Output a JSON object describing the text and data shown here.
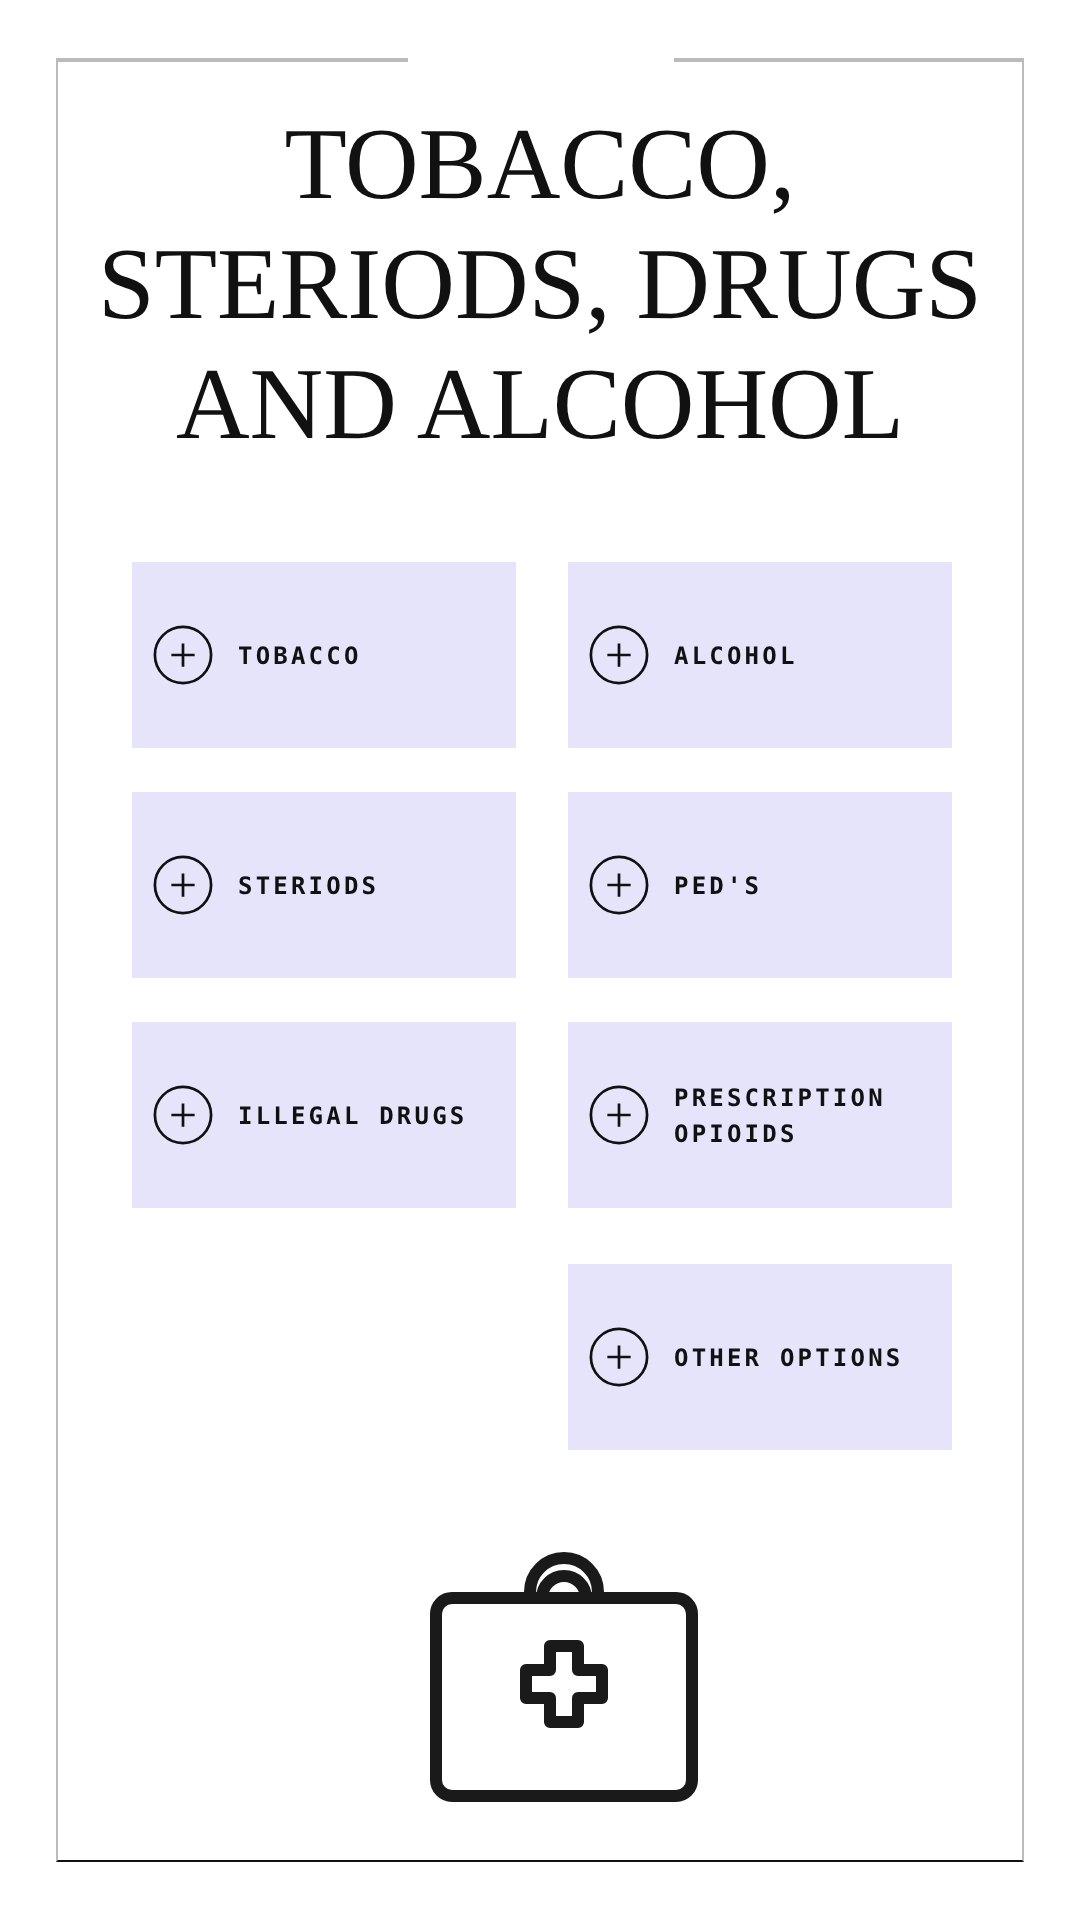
{
  "title": "TOBACCO, STERIODS, DRUGS AND ALCOHOL",
  "topic_columns": [
    {
      "topics": [
        {
          "label": "TOBACCO"
        },
        {
          "label": "STERIODS"
        },
        {
          "label": "ILLEGAL DRUGS"
        }
      ]
    },
    {
      "topics": [
        {
          "label": "ALCOHOL"
        },
        {
          "label": "PED'S"
        },
        {
          "label": "PRESCRIPTION OPIOIDS"
        },
        {
          "label": "OTHER OPTIONS"
        }
      ]
    }
  ]
}
